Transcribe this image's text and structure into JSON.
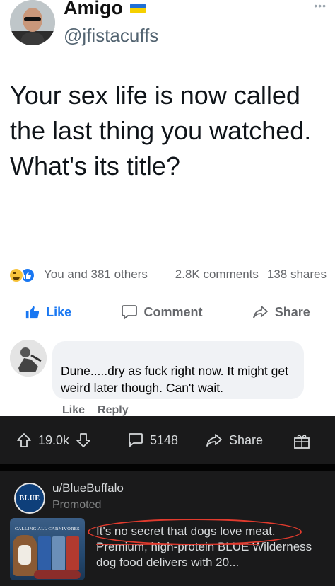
{
  "tweet": {
    "display_name": "Amigo",
    "handle": "@jfistacuffs",
    "text": "Your sex life is now called the last thing you watched. What's its title?"
  },
  "facebook": {
    "reactions_text": "You and 381 others",
    "comments_count": "2.8K comments",
    "shares_count": "138 shares",
    "actions": {
      "like": "Like",
      "comment": "Comment",
      "share": "Share"
    },
    "comment": {
      "text": "Dune.....dry as fuck right now. It might get weird later though. Can't wait.",
      "like_label": "Like",
      "reply_label": "Reply"
    },
    "colors": {
      "like_blue": "#1877f2",
      "meta_gray": "#65676b",
      "bubble_bg": "#f0f2f5"
    }
  },
  "reddit": {
    "upvotes": "19.0k",
    "comments": "5148",
    "share_label": "Share",
    "promoted": {
      "author": "u/BlueBuffalo",
      "tag": "Promoted",
      "logo_text": "BLUE",
      "thumbnail_caption": "CALLING ALL CARNIVORES",
      "text": "It's no secret that dogs love meat. Premium, high-protein BLUE Wilderness dog food delivers with 20..."
    },
    "colors": {
      "background": "#1a1a1b",
      "text": "#d7dadc",
      "highlight": "#e23b2e"
    }
  },
  "icons": [
    "avatar-photo",
    "ukraine-flag-icon",
    "more-dots-icon",
    "haha-reaction-icon",
    "like-reaction-icon",
    "thumbs-up-icon",
    "comment-icon",
    "share-arrow-icon",
    "upvote-icon",
    "downvote-icon",
    "chat-bubble-icon",
    "gift-icon"
  ]
}
